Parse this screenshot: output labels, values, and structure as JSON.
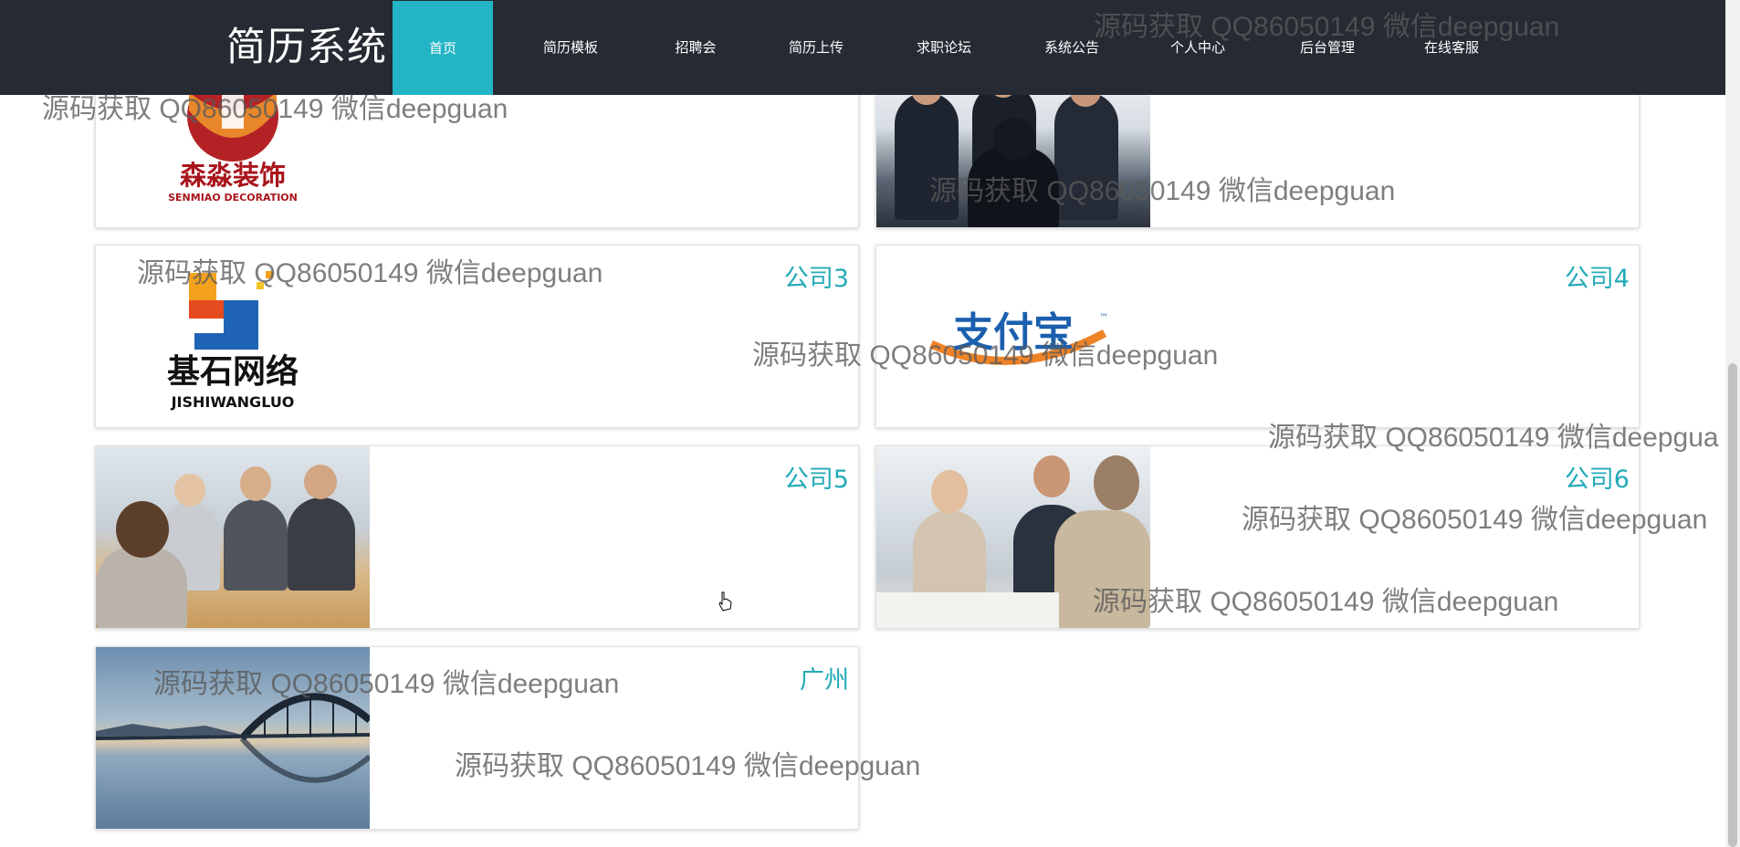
{
  "brand": "简历系统",
  "nav": [
    {
      "label": "首页",
      "active": true
    },
    {
      "label": "简历模板",
      "active": false
    },
    {
      "label": "招聘会",
      "active": false
    },
    {
      "label": "简历上传",
      "active": false
    },
    {
      "label": "求职论坛",
      "active": false
    },
    {
      "label": "系统公告",
      "active": false
    },
    {
      "label": "个人中心",
      "active": false
    },
    {
      "label": "后台管理",
      "active": false
    },
    {
      "label": "在线客服",
      "active": false
    }
  ],
  "cards": {
    "c1": {
      "logo_text": "森淼装饰",
      "logo_sub": "SENMIAO DECORATION"
    },
    "c2": {},
    "c3": {
      "title": "公司3",
      "logo_text": "基石网络",
      "logo_sub": "JISHIWANGLUO"
    },
    "c4": {
      "title": "公司4",
      "logo_text": "支付宝",
      "logo_tm": "™"
    },
    "c5": {
      "title": "公司5"
    },
    "c6": {
      "title": "公司6"
    },
    "c7": {
      "title": "广州"
    }
  },
  "watermark": "源码获取 QQ86050149 微信deepguan",
  "watermark_cut": "源码获取 QQ86050149 微信deepgua",
  "colors": {
    "nav_bg": "#262a33",
    "nav_active": "#23b4c5",
    "title_accent": "#23aab8"
  }
}
